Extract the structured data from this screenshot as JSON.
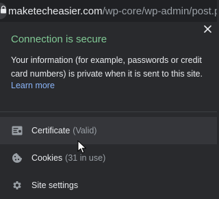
{
  "urlbar": {
    "icon": "lock-icon",
    "domain": "maketecheasier.com",
    "path": "/wp-core/wp-admin/post.php"
  },
  "popup": {
    "title": "Connection is secure",
    "description": "Your information (for example, passwords or credit card numbers) is private when it is sent to this site.",
    "learn_more": "Learn more",
    "close_icon": "close-icon",
    "title_color": "#81c995",
    "link_color": "#8ab4f8",
    "items": [
      {
        "icon": "certificate-icon",
        "label": "Certificate",
        "sub": "(Valid)"
      },
      {
        "icon": "cookie-icon",
        "label": "Cookies",
        "sub": "(31 in use)"
      },
      {
        "icon": "gear-icon",
        "label": "Site settings",
        "sub": ""
      }
    ]
  }
}
